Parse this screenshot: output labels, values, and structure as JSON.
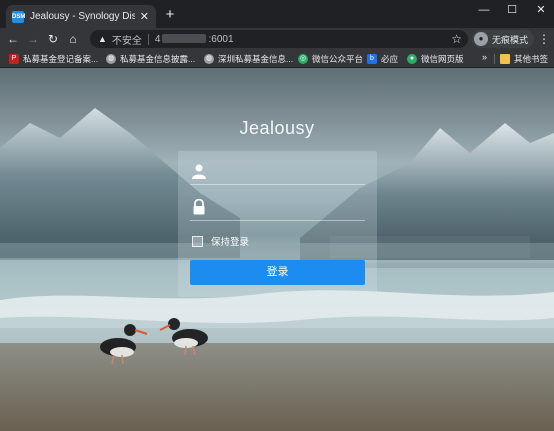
{
  "browser": {
    "tab": {
      "favicon_text": "DSM",
      "title": "Jealousy - Synology DiskStation",
      "close": "✕"
    },
    "new_tab": "+",
    "window_controls": {
      "minimize": "—",
      "maximize": "☐",
      "close": "✕"
    },
    "toolbar": {
      "back": "←",
      "forward": "→",
      "reload": "↻",
      "home": "⌂",
      "security_text": "不安全",
      "url_prefix": "4",
      "url_suffix": ":6001",
      "star": "☆",
      "incognito_label": "无痕模式",
      "menu": "⋮"
    },
    "bookmarks": [
      {
        "label": "私募基金登记备案...",
        "icon": "pdf-icon",
        "color": "#c5221f"
      },
      {
        "label": "私募基金信息披露...",
        "icon": "globe-icon",
        "color": "#9aa0a6"
      },
      {
        "label": "深圳私募基金信息...",
        "icon": "globe-icon",
        "color": "#9aa0a6"
      },
      {
        "label": "微信公众平台",
        "icon": "wechat-mp-icon",
        "color": "#2aae67"
      },
      {
        "label": "必应",
        "icon": "bing-icon",
        "color": "#1a73e8"
      },
      {
        "label": "微信网页版",
        "icon": "wechat-icon",
        "color": "#2aae67"
      }
    ],
    "bookmarks_more": "»",
    "other_bookmarks": "其他书签"
  },
  "login": {
    "server_name": "Jealousy",
    "username_placeholder": "",
    "password_placeholder": "",
    "remember_label": "保持登录",
    "submit_label": "登录"
  },
  "colors": {
    "accent": "#1d8cf0",
    "chrome_dark": "#202124",
    "chrome_light": "#35363a"
  }
}
